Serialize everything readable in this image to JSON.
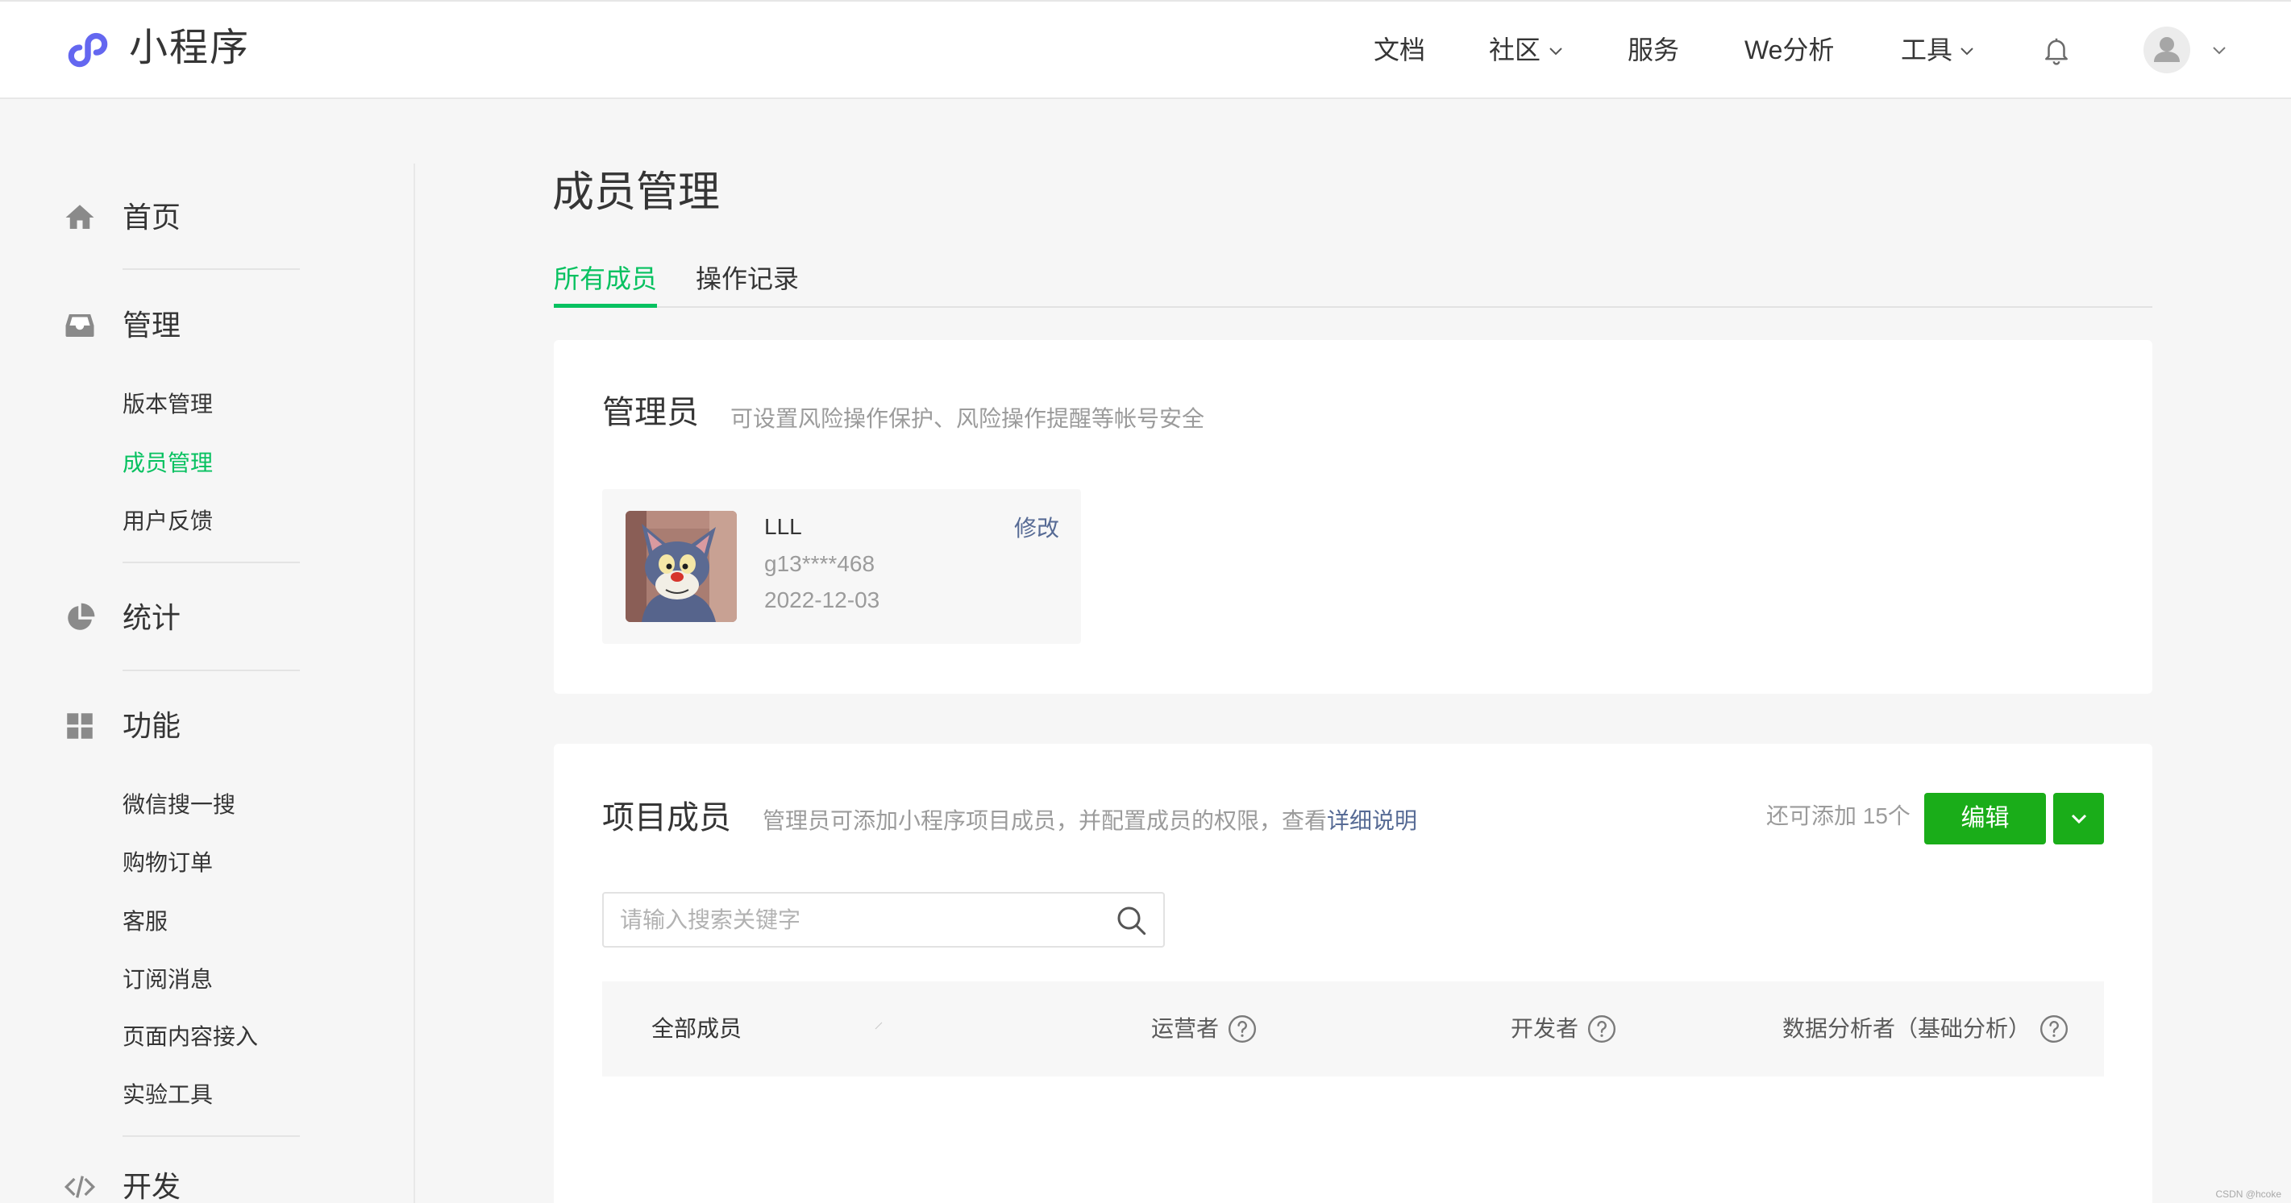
{
  "colors": {
    "brand_green": "#07c160",
    "button_green": "#1aad19",
    "link_blue": "#576b95",
    "logo_purple": "#6467f0"
  },
  "header": {
    "logo_icon": "mini-program-logo-icon",
    "logo_text": "小程序",
    "nav": [
      {
        "label": "文档",
        "icon": null
      },
      {
        "label": "社区",
        "icon": "chevron-down-icon"
      },
      {
        "label": "服务",
        "icon": null
      },
      {
        "label": "We分析",
        "icon": null
      },
      {
        "label": "工具",
        "icon": "chevron-down-icon"
      }
    ],
    "notification_icon": "bell-icon",
    "avatar_icon": "user-icon",
    "account_menu_icon": "chevron-down-icon"
  },
  "sidebar": {
    "active": {
      "group": 1,
      "item": 1
    },
    "groups": [
      {
        "label": "首页",
        "icon": "home-icon",
        "items": []
      },
      {
        "label": "管理",
        "icon": "inbox-icon",
        "items": [
          "版本管理",
          "成员管理",
          "用户反馈"
        ]
      },
      {
        "label": "统计",
        "icon": "pie-chart-icon",
        "items": []
      },
      {
        "label": "功能",
        "icon": "grid-icon",
        "items": [
          "微信搜一搜",
          "购物订单",
          "客服",
          "订阅消息",
          "页面内容接入",
          "实验工具"
        ]
      },
      {
        "label": "开发",
        "icon": "code-icon",
        "items": []
      }
    ]
  },
  "main": {
    "page_title": "成员管理",
    "tabs": [
      {
        "label": "所有成员",
        "active": true
      },
      {
        "label": "操作记录",
        "active": false
      }
    ],
    "admin_section": {
      "title": "管理员",
      "description": "可设置风险操作保护、风险操作提醒等帐号安全",
      "admin": {
        "name": "LLL",
        "wechat_id": "g13****468",
        "date": "2022-12-03",
        "edit_label": "修改"
      }
    },
    "members_section": {
      "title": "项目成员",
      "description": "管理员可添加小程序项目成员，并配置成员的权限，查看",
      "details_link": "详细说明",
      "remaining": "还可添加 15个",
      "edit_button": "编辑",
      "dropdown_icon": "chevron-down-icon",
      "search_placeholder": "请输入搜索关键字",
      "search_icon": "search-icon",
      "columns": [
        {
          "label": "全部成员",
          "help_icon": null
        },
        {
          "label": "运营者",
          "help_icon": "question-circle-icon"
        },
        {
          "label": "开发者",
          "help_icon": "question-circle-icon"
        },
        {
          "label": "数据分析者（基础分析）",
          "help_icon": "question-circle-icon"
        }
      ]
    }
  },
  "watermark": "CSDN @hcoke"
}
